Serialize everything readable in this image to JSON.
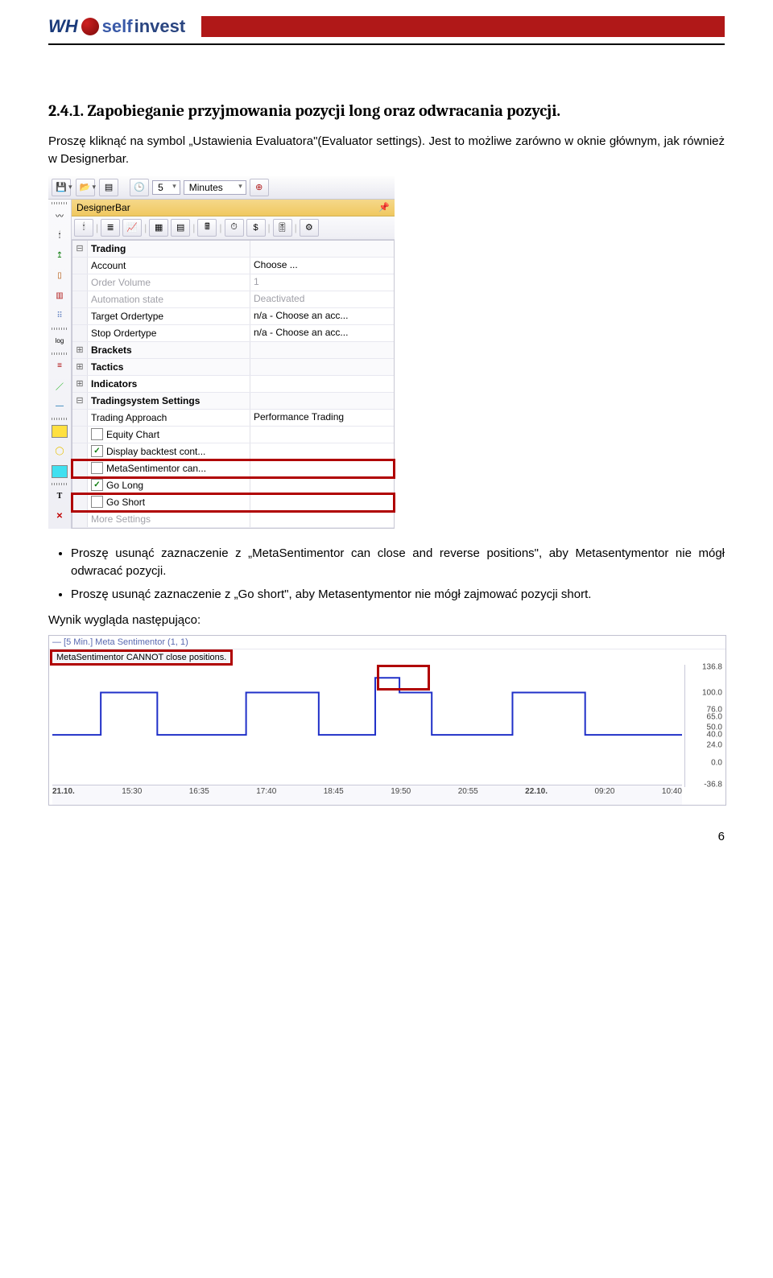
{
  "logo": {
    "wh": "WH",
    "self": "self",
    "invest": "invest"
  },
  "section_title": "2.4.1. Zapobieganie przyjmowania pozycji long oraz odwracania pozycji.",
  "para1": "Proszę kliknąć na symbol „Ustawienia Evaluatora\"(Evaluator settings). Jest to możliwe zarówno w oknie głównym, jak również w Designerbar.",
  "toolbar": {
    "spin_value": "5",
    "timeframe": "Minutes"
  },
  "designerbar": {
    "title": "DesignerBar",
    "categories": {
      "trading": "Trading",
      "brackets": "Brackets",
      "tactics": "Tactics",
      "indicators": "Indicators",
      "ts_settings": "Tradingsystem Settings"
    },
    "rows": {
      "account": {
        "name": "Account",
        "value": "Choose ..."
      },
      "order_volume": {
        "name": "Order Volume",
        "value": "1"
      },
      "automation": {
        "name": "Automation state",
        "value": "Deactivated"
      },
      "target_ot": {
        "name": "Target Ordertype",
        "value": "n/a - Choose an acc..."
      },
      "stop_ot": {
        "name": "Stop Ordertype",
        "value": "n/a - Choose an acc..."
      },
      "approach": {
        "name": "Trading Approach",
        "value": "Performance Trading"
      },
      "equity": {
        "name": "Equity Chart"
      },
      "display_bt": {
        "name": "Display backtest cont..."
      },
      "meta_can": {
        "name": "MetaSentimentor can..."
      },
      "go_long": {
        "name": "Go Long"
      },
      "go_short": {
        "name": "Go Short"
      },
      "more": {
        "name": "More Settings"
      }
    }
  },
  "bullet1": "Proszę usunąć zaznaczenie z „MetaSentimentor can close and reverse positions\", aby Metasentymentor nie mógł odwracać pozycji.",
  "bullet2": "Proszę usunąć zaznaczenie z „Go short\", aby Metasentymentor nie mógł zajmować pozycji short.",
  "result_label": "Wynik wygląda następująco:",
  "chart": {
    "header": "— [5 Min.] Meta Sentimentor  (1, 1)",
    "badge": "MetaSentimentor CANNOT close positions.",
    "y_ticks": [
      "136.8",
      "100.0",
      "76.0",
      "65.0",
      "50.0",
      "40.0",
      "24.0",
      "0.0",
      "-36.8"
    ],
    "x_ticks": [
      "21.10.",
      "15:30",
      "16:35",
      "17:40",
      "18:45",
      "19:50",
      "20:55",
      "22.10.",
      "09:20",
      "10:40"
    ]
  },
  "chart_data": {
    "type": "line",
    "title": "[5 Min.] Meta Sentimentor (1, 1)",
    "xlabel": "",
    "ylabel": "",
    "ylim": [
      -36.8,
      136.8
    ],
    "x": [
      "21.10.",
      "15:30",
      "16:35",
      "17:40",
      "18:45",
      "19:50",
      "20:55",
      "22.10.",
      "09:20",
      "10:40"
    ],
    "y_ticks_labeled": [
      136.8,
      100.0,
      76.0,
      65.0,
      50.0,
      40.0,
      24.0,
      0.0,
      -36.8
    ],
    "series": [
      {
        "name": "Meta Sentimentor",
        "values_step": [
          40,
          40,
          100,
          100,
          40,
          40,
          100,
          100,
          40,
          40,
          120,
          100,
          40,
          40,
          100,
          100,
          40
        ]
      }
    ],
    "annotation": "MetaSentimentor CANNOT close positions."
  },
  "page_number": "6"
}
